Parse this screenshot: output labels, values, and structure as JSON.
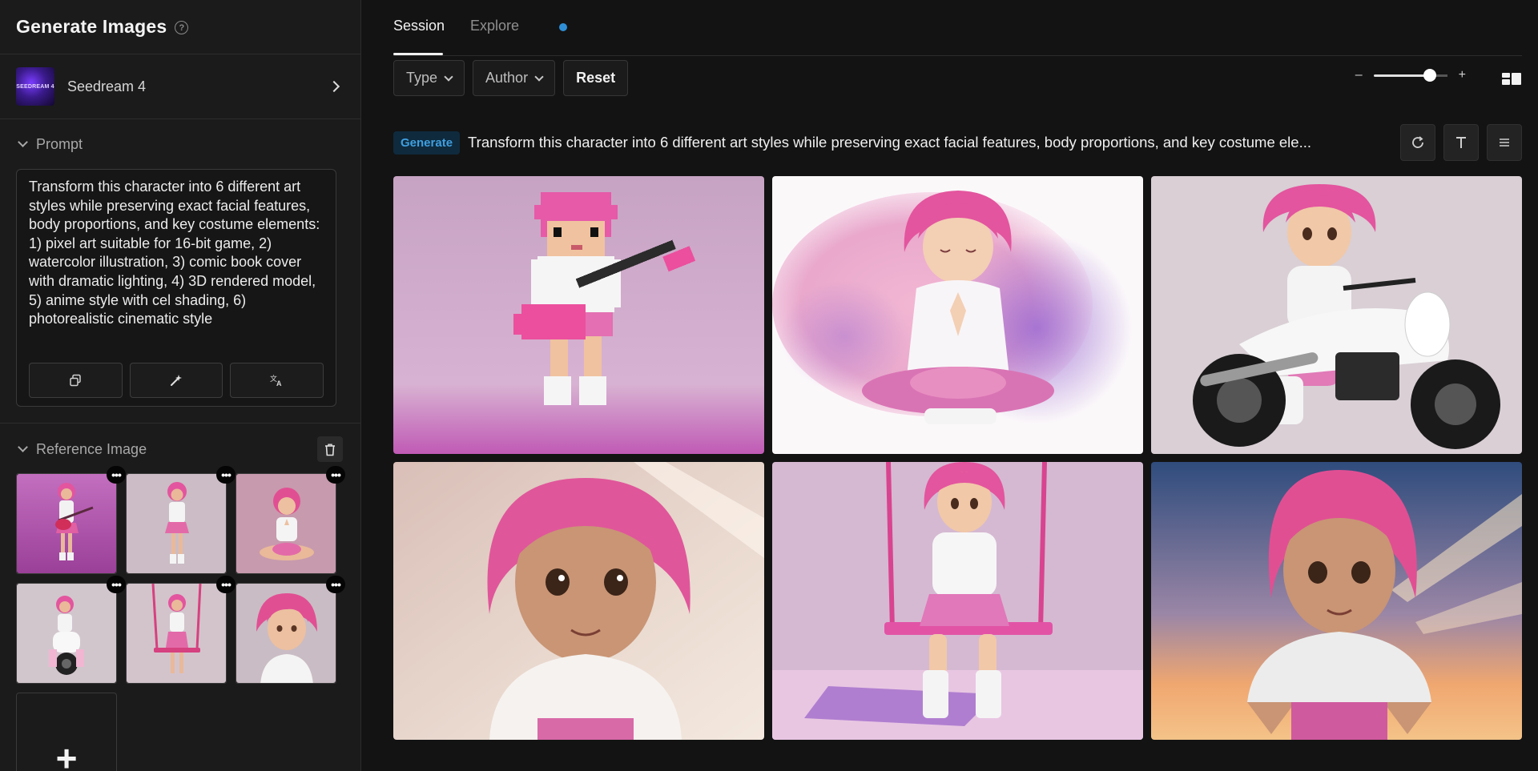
{
  "sidebar": {
    "title": "Generate Images",
    "model": {
      "name": "Seedream 4",
      "thumb_text": "SEEDREAM 4"
    },
    "prompt_section": {
      "label": "Prompt"
    },
    "prompt_text": "Transform this character into 6 different art styles while preserving exact facial features, body proportions, and key costume elements: 1) pixel art suitable for 16-bit game, 2) watercolor illustration, 3) comic book cover with dramatic lighting, 4) 3D rendered model, 5) anime style with cel shading, 6) photorealistic cinematic style",
    "reference_section": {
      "label": "Reference Image"
    },
    "reference_images": [
      {
        "subject": "guitar",
        "menu": "•••"
      },
      {
        "subject": "standing",
        "menu": "•••"
      },
      {
        "subject": "meditating",
        "menu": "•••"
      },
      {
        "subject": "motorcycle",
        "menu": "•••"
      },
      {
        "subject": "swing",
        "menu": "•••"
      },
      {
        "subject": "portrait",
        "menu": "•••"
      }
    ],
    "add_label": "+"
  },
  "tabs": {
    "session": "Session",
    "explore": "Explore"
  },
  "filters": {
    "type": "Type",
    "author": "Author",
    "reset": "Reset"
  },
  "zoom": {
    "minus": "–",
    "plus": "+",
    "level": 0.76
  },
  "generation": {
    "badge": "Generate",
    "prompt": "Transform this character into 6 different art styles while preserving exact facial features, body proportions, and key costume ele..."
  },
  "results": [
    {
      "style": "pixel art guitar"
    },
    {
      "style": "watercolor meditation"
    },
    {
      "style": "3D motorcycle"
    },
    {
      "style": "3D portrait"
    },
    {
      "style": "anime swing"
    },
    {
      "style": "cinematic sunset"
    }
  ],
  "colors": {
    "accent": "#2f8fd6",
    "hair": "#e0569a",
    "badge_bg": "#0f2a3d"
  }
}
